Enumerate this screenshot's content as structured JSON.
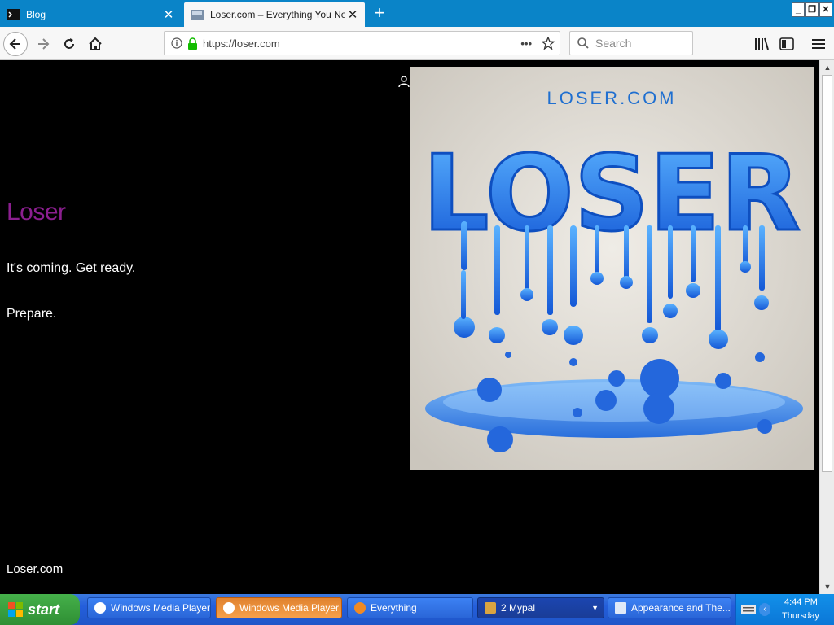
{
  "browser": {
    "tabs": [
      {
        "label": "Blog"
      },
      {
        "label": "Loser.com – Everything You Need"
      }
    ],
    "url": "https://loser.com",
    "search_placeholder": "Search"
  },
  "page": {
    "site_title": "Loser",
    "tagline": "It's coming. Get ready.",
    "prepare": "Prepare.",
    "footer_link": "Loser.com",
    "hero_caption": "LOSER.COM",
    "hero_word": "LOSER"
  },
  "taskbar": {
    "start_label": "start",
    "tasks": [
      {
        "label": "Windows Media Player"
      },
      {
        "label": "Windows Media Player"
      },
      {
        "label": "Everything"
      },
      {
        "label": "2 Mypal"
      },
      {
        "label": "Appearance and The..."
      }
    ],
    "clock_time": "4:44 PM",
    "clock_day": "Thursday"
  },
  "colors": {
    "accent": "#0a84c8",
    "site_title": "#8b1f8f",
    "hero_blue": "#1e6fe0"
  },
  "icons": [
    "back-icon",
    "forward-icon",
    "reload-icon",
    "home-icon",
    "info-icon",
    "lock-icon",
    "more-icon",
    "star-icon",
    "search-icon",
    "library-icon",
    "sidebar-icon",
    "menu-icon",
    "person-icon"
  ]
}
